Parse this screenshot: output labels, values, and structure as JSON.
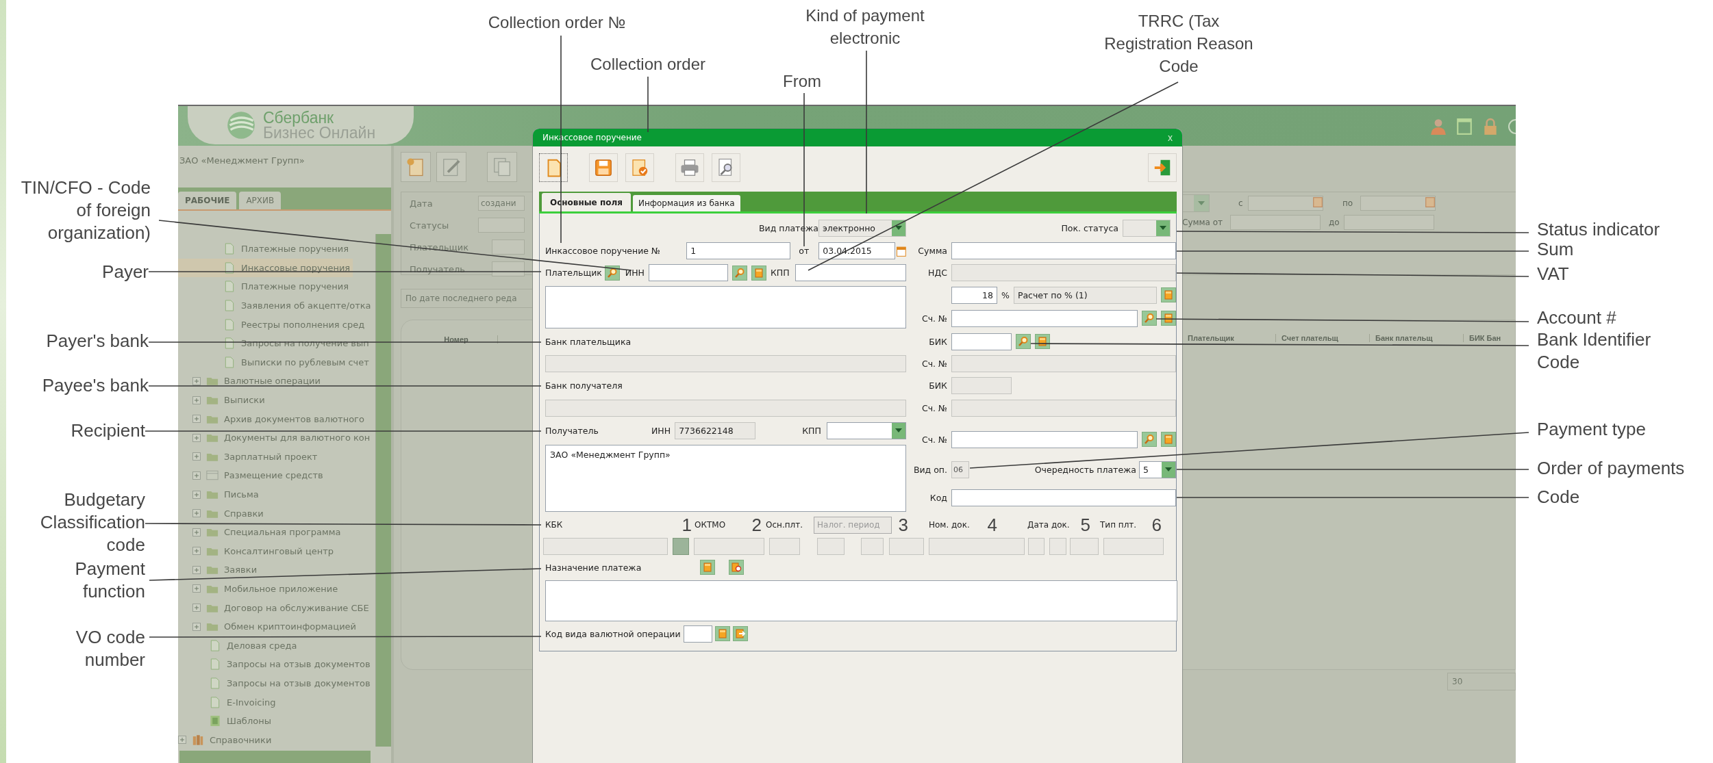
{
  "annotations": {
    "top": [
      "Collection order №",
      "Collection order",
      "From",
      "Kind of payment\nelectronic",
      "TRRC (Tax\nRegistration Reason\nCode"
    ],
    "left": [
      "TIN/CFO - Code\nof foreign\norganization)",
      "Payer",
      "Payer's bank",
      "Payee's bank",
      "Recipient",
      "Budgetary\nClassification\ncode",
      "Payment\nfunction",
      "VO code\nnumber"
    ],
    "right": [
      "Status indicator",
      "Sum",
      "VAT",
      "Account #",
      "Bank Identifier\nCode",
      "Payment type",
      "Order of payments",
      "Code"
    ]
  },
  "app": {
    "logo": {
      "line1": "Сбербанк",
      "line2": "Бизнес Онлайн"
    },
    "organization": "ЗАО «Менеджмент Групп»",
    "tabs": [
      {
        "label": "РАБОЧИЕ",
        "selected": true
      },
      {
        "label": "АРХИВ",
        "selected": false
      }
    ],
    "tree": {
      "items": [
        {
          "kind": "group",
          "children": [
            {
              "label": "Платежные поручения",
              "kind": "doc",
              "selected": false
            },
            {
              "label": "Инкассовые поручения",
              "kind": "doc",
              "selected": true
            },
            {
              "label": "Платежные поручения",
              "kind": "doc",
              "selected": false
            },
            {
              "label": "Заявления об акцепте/отка",
              "kind": "doc",
              "selected": false
            },
            {
              "label": "Реестры пополнения сред",
              "kind": "doc",
              "selected": false
            },
            {
              "label": "Запросы на получение вып",
              "kind": "doc",
              "selected": false
            },
            {
              "label": "Выписки по рублевым счет",
              "kind": "doc",
              "selected": false
            }
          ]
        },
        {
          "label": "Валютные операции",
          "kind": "folder",
          "selected": false
        },
        {
          "label": "Выписки",
          "kind": "folder",
          "selected": false
        },
        {
          "label": "Архив документов валютного",
          "kind": "folder",
          "selected": false
        },
        {
          "label": "Документы для валютного кон",
          "kind": "folder",
          "selected": false
        },
        {
          "label": "Зарплатный проект",
          "kind": "folder",
          "selected": false
        },
        {
          "label": "Размещение средств",
          "kind": "table",
          "selected": false
        },
        {
          "label": "Письма",
          "kind": "folder",
          "selected": false
        },
        {
          "label": "Справки",
          "kind": "folder",
          "selected": false
        },
        {
          "label": "Специальная программа",
          "kind": "folder",
          "selected": false
        },
        {
          "label": "Консалтинговый центр",
          "kind": "folder",
          "selected": false
        },
        {
          "label": "Заявки",
          "kind": "folder",
          "selected": false
        },
        {
          "label": "Мобильное приложение",
          "kind": "folder",
          "selected": false
        },
        {
          "label": "Договор на обслуживание СБЕ",
          "kind": "folder",
          "selected": false
        },
        {
          "label": "Обмен криптоинформацией",
          "kind": "folder",
          "selected": false
        },
        {
          "label": "Деловая среда",
          "kind": "doc",
          "selected": false
        },
        {
          "label": "Запросы на отзыв документов",
          "kind": "doc",
          "selected": false
        },
        {
          "label": "Запросы на отзыв документов",
          "kind": "doc",
          "selected": false
        },
        {
          "label": "E-Invoicing",
          "kind": "doc",
          "selected": false
        },
        {
          "label": "Шаблоны",
          "kind": "template",
          "selected": false
        }
      ],
      "root_items": [
        {
          "label": "Справочники",
          "kind": "books",
          "selected": false
        }
      ]
    },
    "filters": {
      "date_label": "Дата",
      "date_value": "создани",
      "statuses_label": "Статусы",
      "payer_label": "Плательщик",
      "recipient_label": "Получатель",
      "from_label": "с",
      "to_label": "по",
      "sum_from_label": "Сумма от",
      "sum_to_label": "до"
    },
    "sort": "По дате последнего реда",
    "grid": {
      "columns": [
        "Номер",
        "Плательщик",
        "Счет плательщ",
        "Банк плательщ",
        "БИК Бан"
      ]
    },
    "page_size": "30"
  },
  "dialog": {
    "title": "Инкассовое поручение",
    "close": "x",
    "tabs": [
      {
        "label": "Основные поля",
        "selected": true
      },
      {
        "label": "Информация из банка",
        "selected": false
      }
    ],
    "payment_kind": {
      "label": "Вид платежа",
      "value": "электронно"
    },
    "status": {
      "label": "Пок. статуса"
    },
    "order_no": {
      "label": "Инкассовое поручение №",
      "value": "1"
    },
    "date": {
      "label": "от",
      "value": "03.04.2015"
    },
    "sum": {
      "label": "Сумма"
    },
    "payer": {
      "label": "Плательщик",
      "inn_label": "ИНН",
      "kpp_label": "КПП"
    },
    "vat": {
      "label": "НДС",
      "rate": "18",
      "percent": "%",
      "calc": "Расчет по % (1)"
    },
    "payer_account": {
      "label": "Сч. №"
    },
    "payer_bank": {
      "label": "Банк плательщика",
      "bik_label": "БИК",
      "account_label": "Сч. №"
    },
    "payee_bank": {
      "label": "Банк получателя",
      "bik_label": "БИК",
      "account_label": "Сч. №"
    },
    "recipient": {
      "label": "Получатель",
      "inn_label": "ИНН",
      "inn": "7736622148",
      "kpp_label": "КПП",
      "name": "ЗАО «Менеджмент Групп»",
      "account_label": "Сч. №"
    },
    "op_type": {
      "label": "Вид оп.",
      "value": "06"
    },
    "priority": {
      "label": "Очередность платежа",
      "value": "5"
    },
    "code": {
      "label": "Код"
    },
    "budget_labels": [
      {
        "kind": "label",
        "text": "КБК"
      },
      {
        "kind": "number",
        "text": "1"
      },
      {
        "kind": "label",
        "text": "ОКТМО"
      },
      {
        "kind": "number",
        "text": "2"
      },
      {
        "kind": "label",
        "text": "Осн.плт."
      },
      {
        "kind": "field",
        "text": "Налог. период"
      },
      {
        "kind": "number",
        "text": "3"
      },
      {
        "kind": "label",
        "text": "Ном. док."
      },
      {
        "kind": "number",
        "text": "4"
      },
      {
        "kind": "label",
        "text": "Дата док."
      },
      {
        "kind": "number",
        "text": "5"
      },
      {
        "kind": "label",
        "text": "Тип плт."
      },
      {
        "kind": "number",
        "text": "6"
      }
    ],
    "purpose": {
      "label": "Назначение платежа"
    },
    "currency_op": {
      "label": "Код вида валютной операции"
    }
  }
}
